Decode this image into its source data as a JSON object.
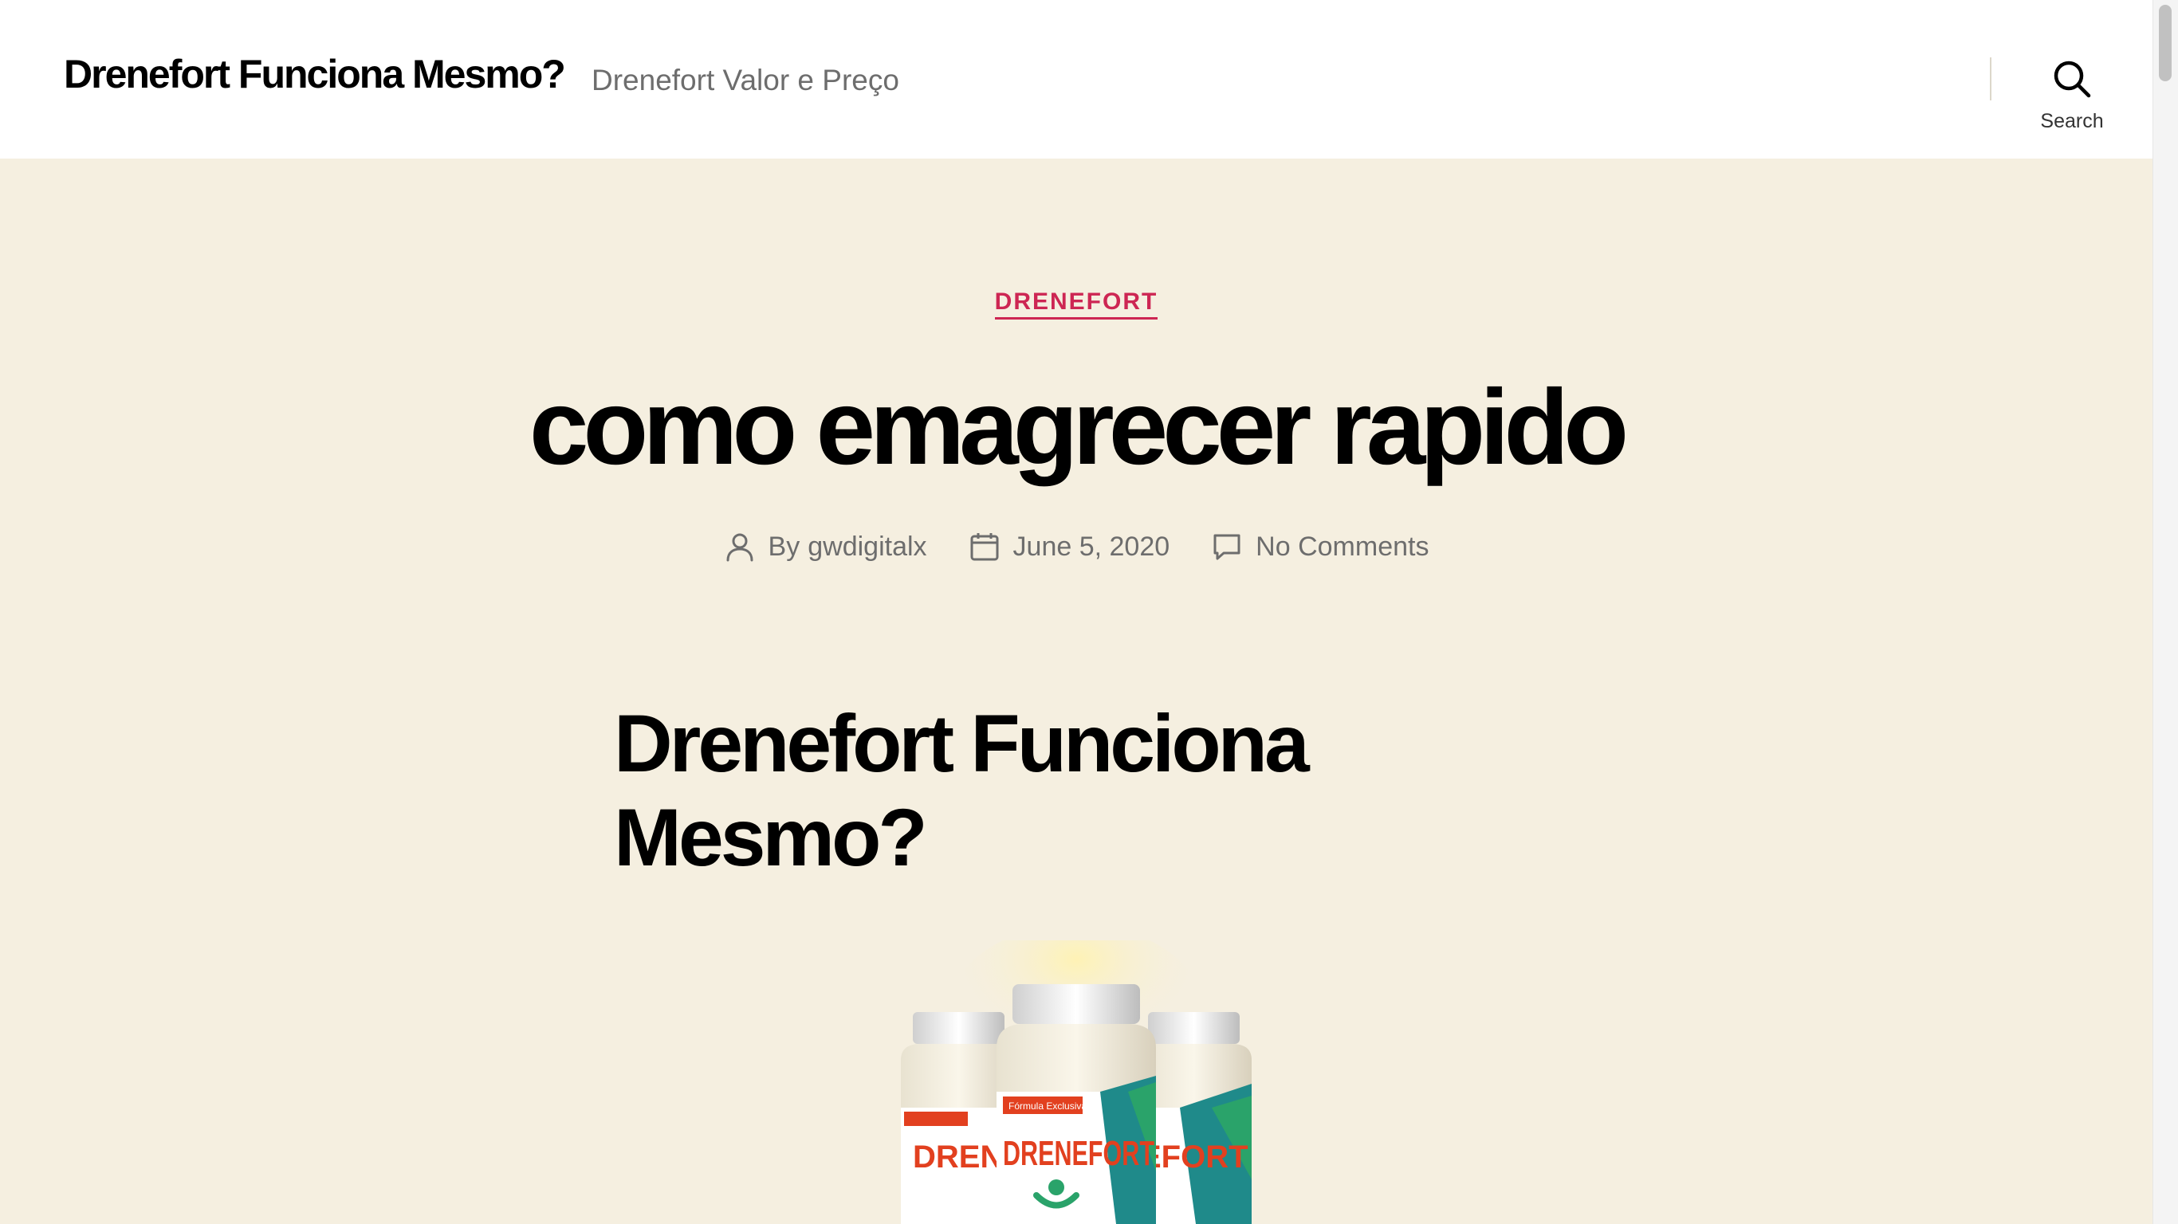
{
  "header": {
    "site_title": "Drenefort Funciona Mesmo?",
    "site_description": "Drenefort Valor e Preço",
    "search_label": "Search"
  },
  "post": {
    "category": "DRENEFORT",
    "title": "como emagrecer rapido",
    "meta": {
      "author_prefix": "By",
      "author": "gwdigitalx",
      "date": "June 5, 2020",
      "comments": "No Comments"
    }
  },
  "content": {
    "heading_line1": "Drenefort Funciona",
    "heading_line2": "Mesmo?",
    "product_badge": "Fórmula Exclusiva",
    "product_brand": "DRENEFORT"
  },
  "colors": {
    "accent": "#cd2653",
    "background": "#f5efe0",
    "header_bg": "#ffffff",
    "meta_text": "#6d6d6d"
  },
  "icons": {
    "search": "search-icon",
    "author": "user-icon",
    "date": "calendar-icon",
    "comments": "comment-icon"
  }
}
